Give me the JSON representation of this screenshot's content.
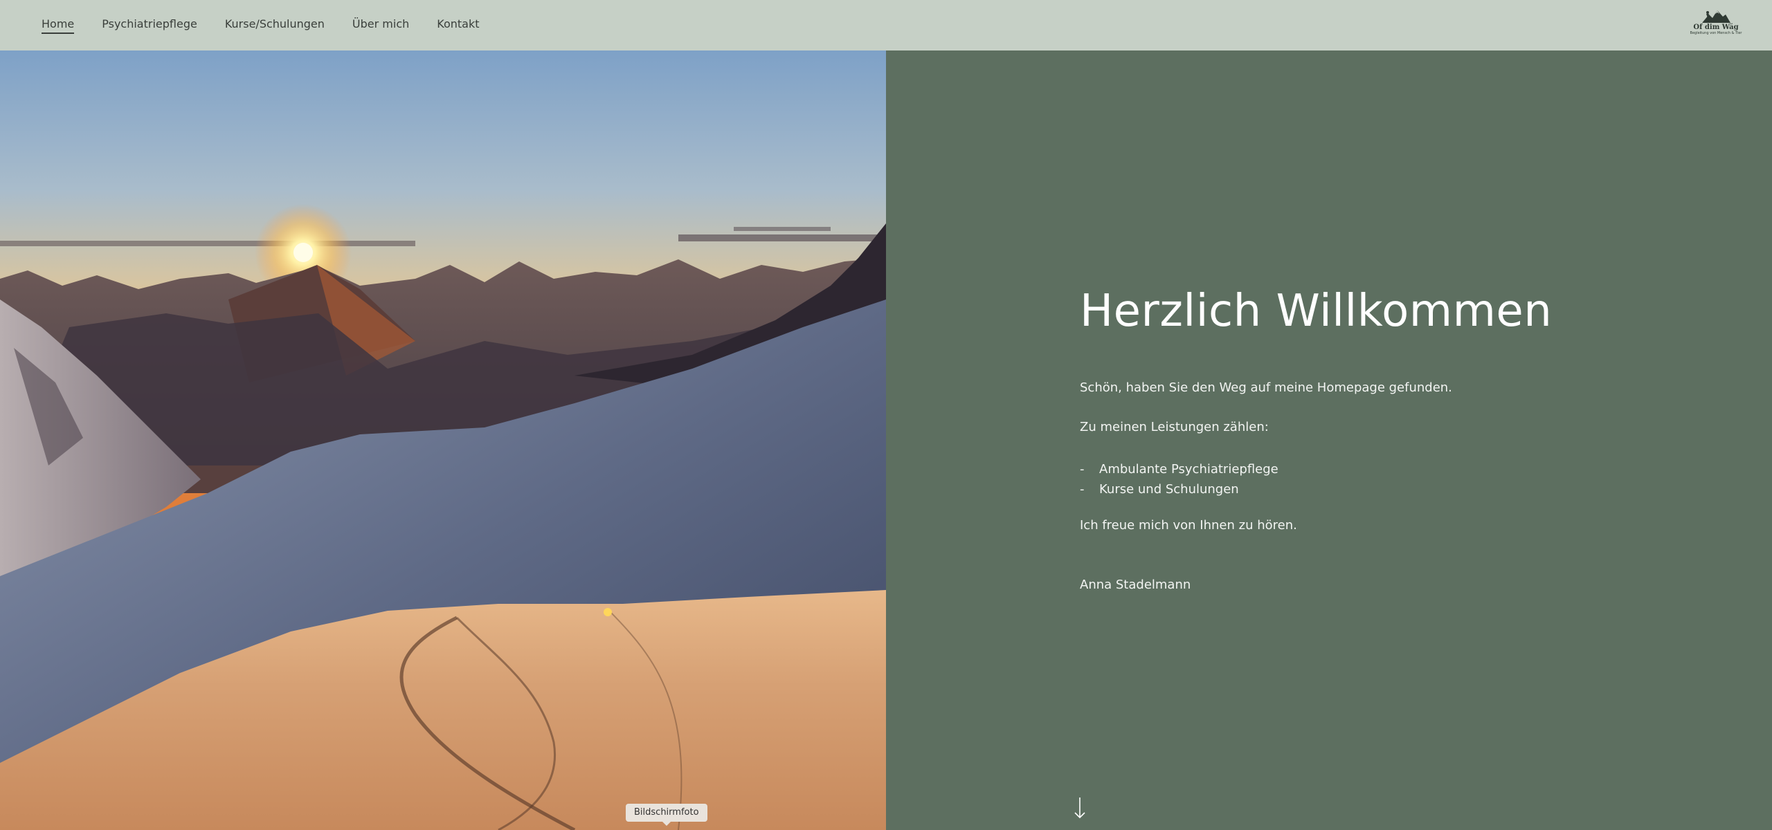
{
  "nav": {
    "items": [
      {
        "label": "Home",
        "active": true
      },
      {
        "label": "Psychiatriepflege",
        "active": false
      },
      {
        "label": "Kurse/Schulungen",
        "active": false
      },
      {
        "label": "Über mich",
        "active": false
      },
      {
        "label": "Kontakt",
        "active": false
      }
    ]
  },
  "logo": {
    "title": "Of dim Wäg",
    "subtitle": "Begleitung von Mensch & Tier"
  },
  "hero": {
    "image_icon": "mountain-sunrise-photo",
    "tooltip": "Bildschirmfoto"
  },
  "content": {
    "title": "Herzlich Willkommen",
    "intro": "Schön, haben Sie den Weg auf meine Homepage gefunden.",
    "services_label": "Zu meinen Leistungen zählen:",
    "services": [
      {
        "dash": "-",
        "text": "Ambulante Psychiatriepflege"
      },
      {
        "dash": "-",
        "text": "Kurse und Schulungen"
      }
    ],
    "closing": "Ich freue mich von Ihnen zu hören.",
    "signature": "Anna Stadelmann",
    "scroll_icon": "arrow-down-icon"
  },
  "colors": {
    "header_bg": "#c6d0c6",
    "content_bg": "#5d6f60",
    "text": "#ffffff"
  }
}
